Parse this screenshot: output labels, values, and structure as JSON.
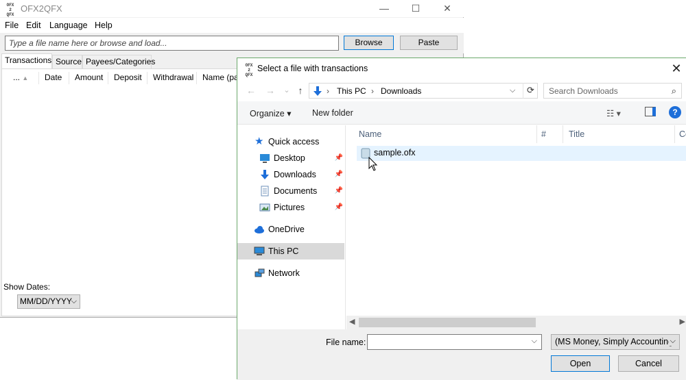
{
  "main_window": {
    "icon_text": "OFX\n2\nQFX",
    "title": "OFX2QFX",
    "caption": {
      "minimize": "—",
      "maximize": "☐",
      "close": "✕"
    },
    "menu": [
      "File",
      "Edit",
      "Language",
      "Help"
    ],
    "file_input_placeholder": "Type a file name here or browse and load...",
    "browse_label": "Browse",
    "paste_label": "Paste",
    "tabs": [
      "Transactions",
      "Source",
      "Payees/Categories"
    ],
    "columns": [
      "...",
      "Date",
      "Amount",
      "Deposit",
      "Withdrawal",
      "Name (pay"
    ],
    "show_dates_label": "Show Dates:",
    "date_format": "MM/DD/YYYY"
  },
  "dialog": {
    "title": "Select a file with transactions",
    "close": "✕",
    "nav": {
      "back": "←",
      "forward": "→",
      "dropdown": "⌄",
      "up": "↑"
    },
    "breadcrumb": [
      "This PC",
      "Downloads"
    ],
    "breadcrumb_sep": "›",
    "search_placeholder": "Search Downloads",
    "organize_label": "Organize ▾",
    "new_folder_label": "New folder",
    "help_glyph": "?",
    "nav_items": [
      {
        "label": "Quick access",
        "icon": "star-icon"
      },
      {
        "label": "Desktop",
        "icon": "desktop-icon",
        "pinned": true
      },
      {
        "label": "Downloads",
        "icon": "download-icon",
        "pinned": true
      },
      {
        "label": "Documents",
        "icon": "documents-icon",
        "pinned": true
      },
      {
        "label": "Pictures",
        "icon": "pictures-icon",
        "pinned": true
      },
      {
        "label": "OneDrive",
        "icon": "cloud-icon"
      },
      {
        "label": "This PC",
        "icon": "pc-icon",
        "selected": true
      },
      {
        "label": "Network",
        "icon": "network-icon"
      }
    ],
    "file_columns": [
      "Name",
      "#",
      "Title",
      "Co"
    ],
    "files": [
      {
        "name": "sample.ofx"
      }
    ],
    "file_name_label": "File name:",
    "file_name_value": "",
    "file_type": "(MS Money, Simply Accounting",
    "open_label": "Open",
    "cancel_label": "Cancel"
  }
}
